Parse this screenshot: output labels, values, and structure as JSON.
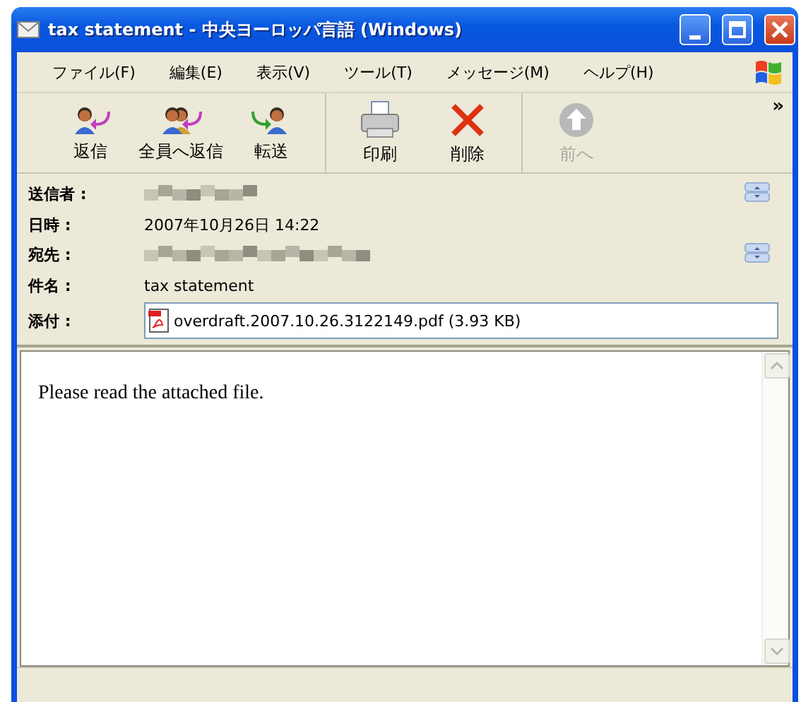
{
  "window": {
    "title": "tax statement - 中央ヨーロッパ言語 (Windows)"
  },
  "menu": [
    "ファイル(F)",
    "編集(E)",
    "表示(V)",
    "ツール(T)",
    "メッセージ(M)",
    "ヘルプ(H)"
  ],
  "toolbar": [
    [
      {
        "label": "返信",
        "disabled": false
      },
      {
        "label": "全員へ返信",
        "disabled": false
      },
      {
        "label": "転送",
        "disabled": false
      }
    ],
    [
      {
        "label": "印刷",
        "disabled": false
      },
      {
        "label": "削除",
        "disabled": false
      }
    ],
    [
      {
        "label": "前へ",
        "disabled": true
      }
    ]
  ],
  "toolbar_overflow": "»",
  "headers": [
    {
      "label": "送信者 :",
      "kind": "redacted",
      "expander": true
    },
    {
      "label": "日時 :",
      "kind": "text",
      "value": "2007年10月26日 14:22",
      "expander": false
    },
    {
      "label": "宛先 :",
      "kind": "redacted",
      "expander": true
    },
    {
      "label": "件名 :",
      "kind": "text",
      "value": "tax statement",
      "expander": false
    },
    {
      "label": "添付 :",
      "kind": "attachment",
      "value": "overdraft.2007.10.26.3122149.pdf (3.93 KB)",
      "expander": false
    }
  ],
  "body": "Please read the attached file."
}
